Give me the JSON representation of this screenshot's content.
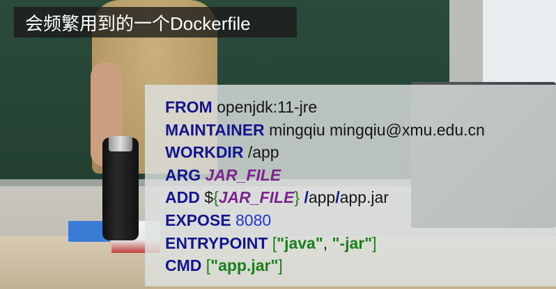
{
  "title": "会频繁用到的一个Dockerfile",
  "code": {
    "from_kw": "FROM",
    "from_val": "openjdk:11-jre",
    "maintainer_kw": "MAINTAINER",
    "maintainer_val": "mingqiu mingqiu@xmu.edu.cn",
    "workdir_kw": "WORKDIR",
    "workdir_val": "/app",
    "arg_kw": "ARG",
    "arg_val": "JAR_FILE",
    "add_kw": "ADD",
    "add_dollar": "$",
    "add_lbrace": "{",
    "add_var": "JAR_FILE",
    "add_rbrace": "}",
    "add_space": " ",
    "add_slash1": "/",
    "add_app": "app",
    "add_slash2": "/",
    "add_jar": "app.jar",
    "expose_kw": "EXPOSE",
    "expose_val": "8080",
    "entrypoint_kw": "ENTRYPOINT",
    "entrypoint_open": "[",
    "entrypoint_java": "\"java\"",
    "entrypoint_comma": ",",
    "entrypoint_jar": "\"-jar\"",
    "entrypoint_close": "]",
    "cmd_kw": "CMD",
    "cmd_open": "[",
    "cmd_val": "\"app.jar\"",
    "cmd_close": "]"
  },
  "colors": {
    "keyword": "#13158f",
    "variable": "#7a248c",
    "number": "#1e34d6",
    "string": "#1a7f1a"
  }
}
